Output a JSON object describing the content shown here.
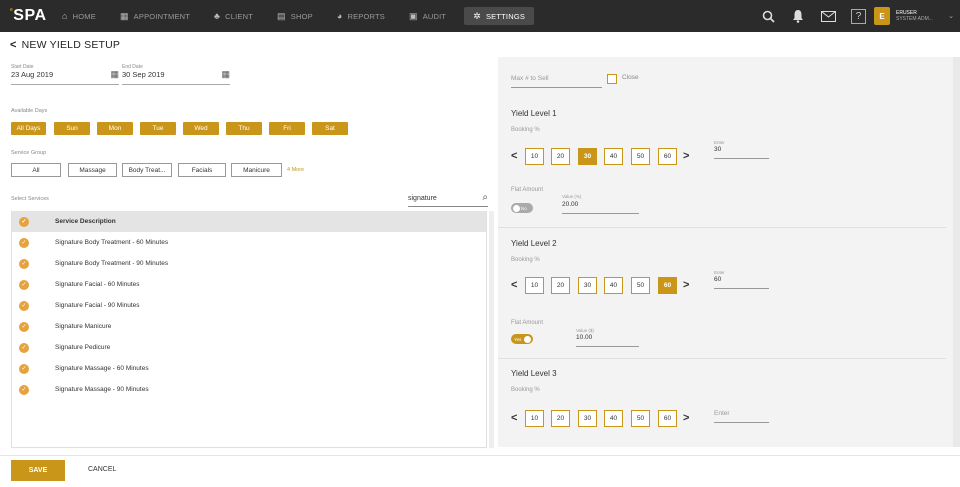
{
  "app": {
    "logo_main": "SPA",
    "logo_prefix": "e"
  },
  "nav": [
    {
      "label": "HOME",
      "icon": "home-icon",
      "glyph": "⌂"
    },
    {
      "label": "APPOINTMENT",
      "icon": "calendar-icon",
      "glyph": "▦"
    },
    {
      "label": "CLIENT",
      "icon": "client-icon",
      "glyph": "♣"
    },
    {
      "label": "SHOP",
      "icon": "shop-icon",
      "glyph": "▤"
    },
    {
      "label": "REPORTS",
      "icon": "reports-icon",
      "glyph": "◕"
    },
    {
      "label": "AUDIT",
      "icon": "audit-icon",
      "glyph": "▣"
    },
    {
      "label": "SETTINGS",
      "icon": "settings-icon",
      "glyph": "✲"
    }
  ],
  "user": {
    "initial": "E",
    "name": "ERUSER",
    "role": "SYSTEM ADM..."
  },
  "page": {
    "title": "NEW YIELD SETUP"
  },
  "dates": {
    "start_label": "Start Date",
    "start_value": "23 Aug 2019",
    "end_label": "End Date",
    "end_value": "30 Sep 2019"
  },
  "available_days": {
    "label": "Available Days",
    "days": [
      "All Days",
      "Sun",
      "Mon",
      "Tue",
      "Wed",
      "Thu",
      "Fri",
      "Sat"
    ]
  },
  "service_group": {
    "label": "Service Group",
    "items": [
      "All",
      "Massage",
      "Body Treat...",
      "Facials",
      "Manicure"
    ],
    "more": "4 More"
  },
  "services": {
    "label": "Select Services",
    "search_value": "signature",
    "header": "Service Description",
    "rows": [
      "Signature Body Treatment - 60 Minutes",
      "Signature Body Treatment - 90 Minutes",
      "Signature Facial - 60 Minutes",
      "Signature Facial - 90 Minutes",
      "Signature Manicure",
      "Signature Pedicure",
      "Signature Massage - 60 Minutes",
      "Signature Massage - 90 Minutes"
    ]
  },
  "right": {
    "max_sell_placeholder": "Max # to Sell",
    "close_label": "Close",
    "levels": [
      {
        "title": "Yield Level 1",
        "sub": "Booking %",
        "options": [
          "10",
          "20",
          "30",
          "40",
          "50",
          "60"
        ],
        "selected": "30",
        "enter_label": "Enter",
        "enter_value": "30",
        "flat_label": "Flat Amount",
        "toggle": "No",
        "value_label": "Value (%)",
        "value": "20.00"
      },
      {
        "title": "Yield Level 2",
        "sub": "Booking %",
        "options": [
          "10",
          "20",
          "30",
          "40",
          "50",
          "60"
        ],
        "selected": "60",
        "enter_label": "Enter",
        "enter_value": "60",
        "flat_label": "Flat Amount",
        "toggle": "Yes",
        "value_label": "Value ($)",
        "value": "10.00"
      },
      {
        "title": "Yield Level 3",
        "sub": "Booking %",
        "options": [
          "10",
          "20",
          "30",
          "40",
          "50",
          "60"
        ],
        "selected": "",
        "enter_placeholder": "Enter"
      }
    ]
  },
  "footer": {
    "save": "SAVE",
    "cancel": "CANCEL"
  },
  "colors": {
    "accent": "#c9961a",
    "topbar": "#2b2b2b",
    "check": "#e6a23c"
  }
}
